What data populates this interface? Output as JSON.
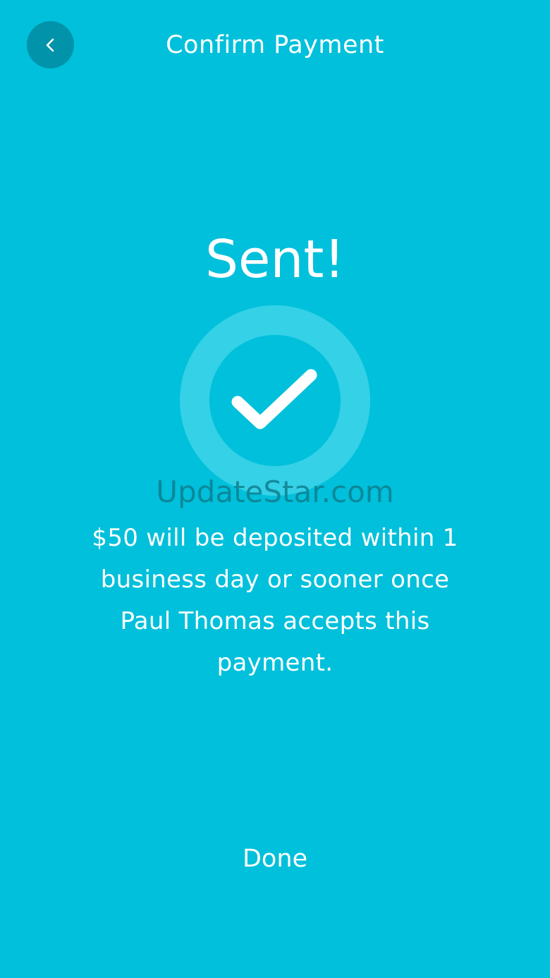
{
  "header": {
    "title": "Confirm Payment",
    "back_icon": "chevron-left-icon"
  },
  "status": {
    "title": "Sent!",
    "icon": "checkmark-icon"
  },
  "watermark": "UpdateStar.com",
  "message": "$50 will be deposited within 1 business day or sooner once Paul Thomas accepts this payment.",
  "actions": {
    "done_label": "Done"
  },
  "colors": {
    "background": "#00C0DB",
    "back_button": "#0193A9",
    "ring": "#34D1E7",
    "text": "#FFFFFF"
  }
}
